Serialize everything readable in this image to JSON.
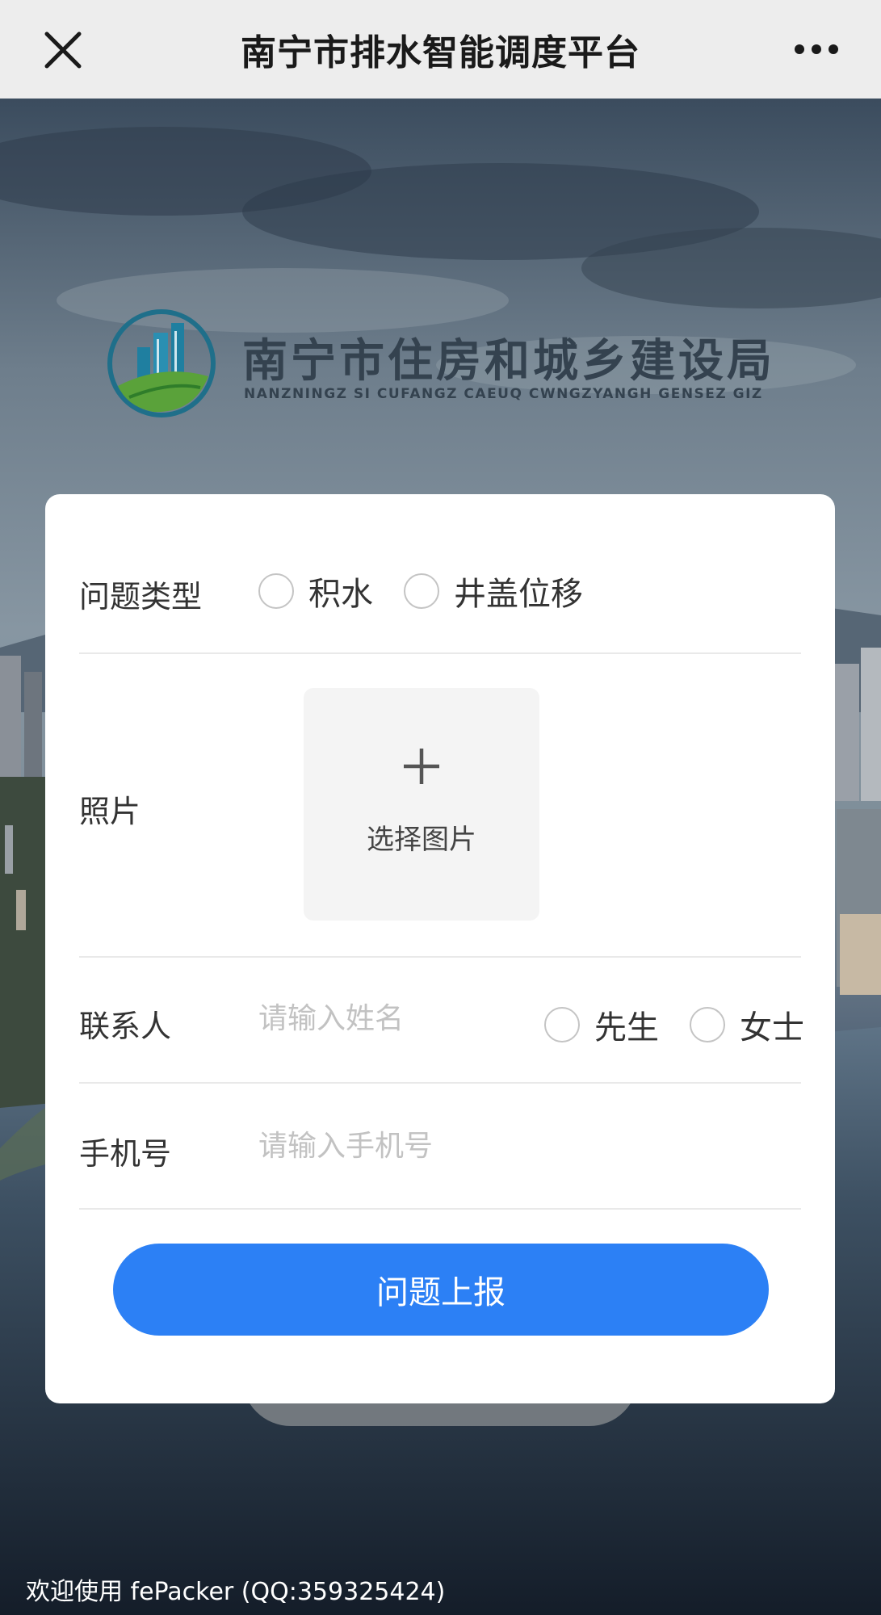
{
  "window": {
    "title": "南宁市排水智能调度平台",
    "close_icon": "close-icon",
    "more_icon": "more-dots-icon"
  },
  "logo": {
    "name_cn": "南宁市住房和城乡建设局",
    "name_en": "NANZNINGZ SI CUFANGZ CAEUQ CWNGZYANGH GENSEZ GIZ"
  },
  "form": {
    "issue_type": {
      "label": "问题类型",
      "options": [
        "积水",
        "井盖位移"
      ]
    },
    "photo": {
      "label": "照片",
      "upload_label": "选择图片",
      "upload_icon": "plus-icon"
    },
    "contact": {
      "label": "联系人",
      "placeholder": "请输入姓名",
      "value": "",
      "salutations": [
        "先生",
        "女士"
      ]
    },
    "phone": {
      "label": "手机号",
      "placeholder": "请输入手机号",
      "value": ""
    },
    "submit_label": "问题上报"
  },
  "footer": {
    "watermark": "欢迎使用 fePacker (QQ:359325424)"
  },
  "colors": {
    "accent": "#2c80f5",
    "topbar": "#ededed",
    "card": "#ffffff"
  }
}
